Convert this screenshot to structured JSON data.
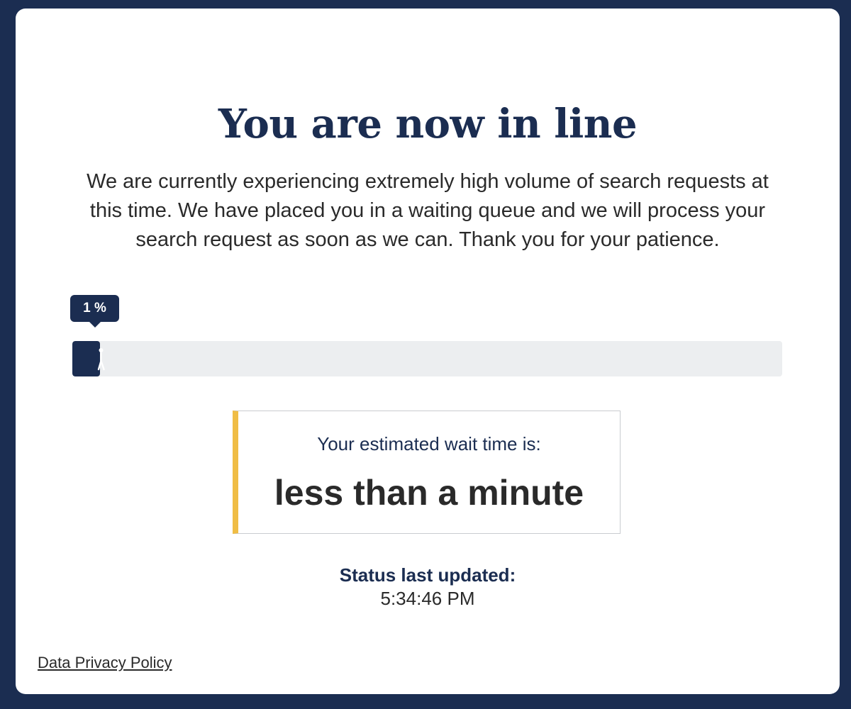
{
  "page": {
    "title": "You are now in line",
    "message": "We are currently experiencing extremely high volume of search requests at this time. We have placed you in a waiting queue and we will process your search request as soon as we can. Thank you for your patience."
  },
  "progress": {
    "label": "1 %",
    "percent": 1,
    "icon": "walking-person-icon"
  },
  "wait": {
    "label": "Your estimated wait time is:",
    "value": "less than a minute"
  },
  "status": {
    "label": "Status last updated:",
    "time": "5:34:46 PM"
  },
  "footer": {
    "privacy_link": "Data Privacy Policy"
  },
  "colors": {
    "navy": "#1b2d51",
    "accent_yellow": "#f0bd45",
    "track": "#eceef0",
    "text": "#2a2a2a"
  }
}
